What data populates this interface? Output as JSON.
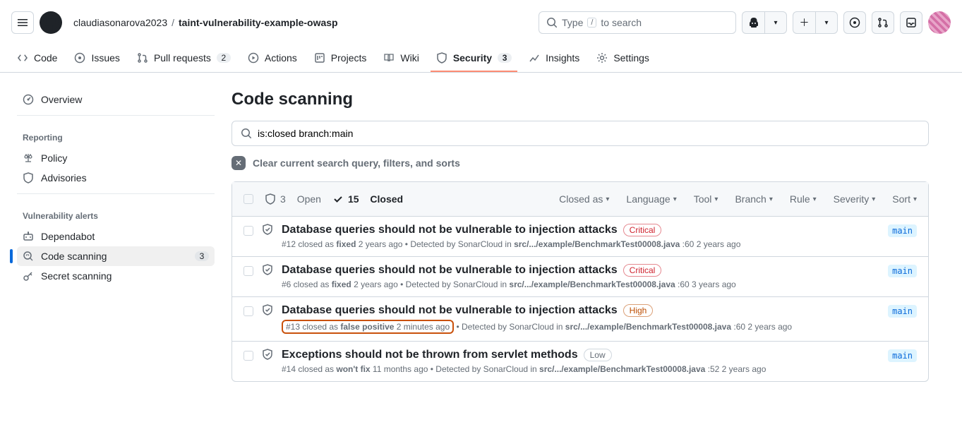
{
  "header": {
    "owner": "claudiasonarova2023",
    "repo": "taint-vulnerability-example-owasp",
    "search_placeholder": "Type",
    "search_hint": "to search",
    "search_kbd": "/"
  },
  "repo_nav": {
    "code": "Code",
    "issues": "Issues",
    "pulls": "Pull requests",
    "pulls_count": "2",
    "actions": "Actions",
    "projects": "Projects",
    "wiki": "Wiki",
    "security": "Security",
    "security_count": "3",
    "insights": "Insights",
    "settings": "Settings"
  },
  "sidebar": {
    "overview": "Overview",
    "reporting_header": "Reporting",
    "policy": "Policy",
    "advisories": "Advisories",
    "vuln_header": "Vulnerability alerts",
    "dependabot": "Dependabot",
    "code_scanning": "Code scanning",
    "code_scanning_count": "3",
    "secret_scanning": "Secret scanning"
  },
  "main": {
    "title": "Code scanning",
    "filter_value": "is:closed branch:main",
    "clear_text": "Clear current search query, filters, and sorts"
  },
  "list_header": {
    "open_count": "3",
    "open_label": "Open",
    "closed_count": "15",
    "closed_label": "Closed",
    "filters": {
      "closed_as": "Closed as",
      "language": "Language",
      "tool": "Tool",
      "branch": "Branch",
      "rule": "Rule",
      "severity": "Severity",
      "sort": "Sort"
    }
  },
  "alerts": [
    {
      "title": "Database queries should not be vulnerable to injection attacks",
      "severity": "Critical",
      "sev_class": "sev-critical",
      "branch": "main",
      "meta_prefix": "#12 closed as ",
      "meta_status": "fixed",
      "meta_when": " 2 years ago",
      "meta_detect": " • Detected by SonarCloud in ",
      "meta_file": "src/.../example/BenchmarkTest00008.java",
      "meta_line": " :60 2 years ago",
      "highlight": false
    },
    {
      "title": "Database queries should not be vulnerable to injection attacks",
      "severity": "Critical",
      "sev_class": "sev-critical",
      "branch": "main",
      "meta_prefix": "#6 closed as ",
      "meta_status": "fixed",
      "meta_when": " 2 years ago",
      "meta_detect": " • Detected by SonarCloud in ",
      "meta_file": "src/.../example/BenchmarkTest00008.java",
      "meta_line": " :60 3 years ago",
      "highlight": false
    },
    {
      "title": "Database queries should not be vulnerable to injection attacks",
      "severity": "High",
      "sev_class": "sev-high",
      "branch": "main",
      "meta_prefix": "#13 closed as ",
      "meta_status": "false positive",
      "meta_when": " 2 minutes ago",
      "meta_detect": " • Detected by SonarCloud in ",
      "meta_file": "src/.../example/BenchmarkTest00008.java",
      "meta_line": " :60 2 years ago",
      "highlight": true
    },
    {
      "title": "Exceptions should not be thrown from servlet methods",
      "severity": "Low",
      "sev_class": "sev-low",
      "branch": "main",
      "meta_prefix": "#14 closed as ",
      "meta_status": "won't fix",
      "meta_when": " 11 months ago",
      "meta_detect": " • Detected by SonarCloud in ",
      "meta_file": "src/.../example/BenchmarkTest00008.java",
      "meta_line": " :52 2 years ago",
      "highlight": false
    }
  ]
}
